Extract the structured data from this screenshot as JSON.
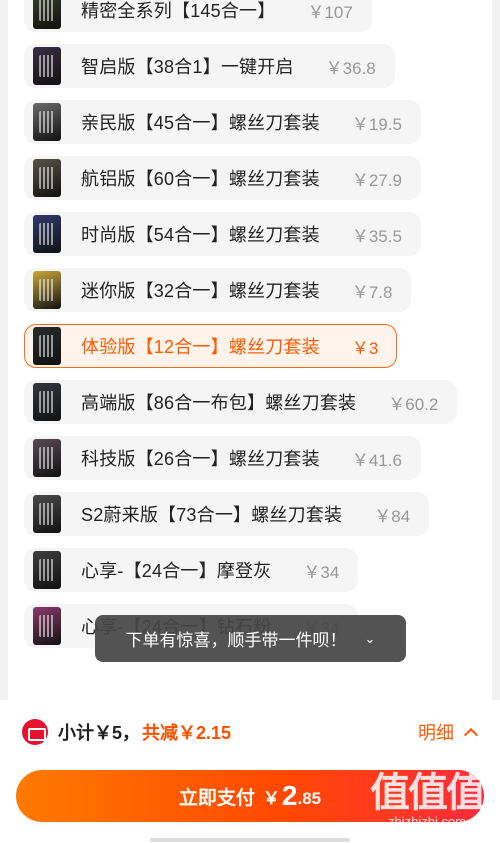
{
  "sku_list": {
    "items": [
      {
        "name": "精密全系列【145合一】",
        "price": "￥107",
        "thumb_color": "#3a3f2a",
        "selected": false
      },
      {
        "name": "智启版【38合1】一键开启",
        "price": "￥36.8",
        "thumb_color": "#3b2d45",
        "selected": false
      },
      {
        "name": "亲民版【45合一】螺丝刀套装",
        "price": "￥19.5",
        "thumb_color": "#6a6a6a",
        "selected": false
      },
      {
        "name": "航铝版【60合一】螺丝刀套装",
        "price": "￥27.9",
        "thumb_color": "#5a5248",
        "selected": false
      },
      {
        "name": "时尚版【54合一】螺丝刀套装",
        "price": "￥35.5",
        "thumb_color": "#2f3a6a",
        "selected": false
      },
      {
        "name": "迷你版【32合一】螺丝刀套装",
        "price": "￥7.8",
        "thumb_color": "#c9a93a",
        "selected": false
      },
      {
        "name": "体验版【12合一】螺丝刀套装",
        "price": "￥3",
        "thumb_color": "#2a2a2a",
        "selected": true
      },
      {
        "name": "高端版【86合一布包】螺丝刀套装",
        "price": "￥60.2",
        "thumb_color": "#33373d",
        "selected": false
      },
      {
        "name": "科技版【26合一】螺丝刀套装",
        "price": "￥41.6",
        "thumb_color": "#5a4a55",
        "selected": false
      },
      {
        "name": "S2蔚来版【73合一】螺丝刀套装",
        "price": "￥84",
        "thumb_color": "#4a4a4a",
        "selected": false
      },
      {
        "name": "心享-【24合一】摩登灰",
        "price": "￥34",
        "thumb_color": "#3d3d3d",
        "selected": false
      },
      {
        "name": "心享-【24合一】钻石粉",
        "price": "￥34",
        "thumb_color": "#8a3a6a",
        "selected": false
      }
    ]
  },
  "toast": {
    "text": "下单有惊喜，顺手带一件呗！",
    "arrow": "⌄"
  },
  "summary": {
    "subtotal": "小计￥5",
    "separator": "，",
    "discount": "共减￥2.15",
    "detail_label": "明细"
  },
  "pay_button": {
    "label": "立即支付",
    "currency": "￥",
    "amount_int": "2",
    "amount_dec": ".85"
  },
  "watermark": {
    "logo": "值值值",
    "url": "zhizhizhi.com"
  },
  "colors": {
    "accent": "#ff5a00",
    "discount_red": "#ff5000",
    "ticket_red": "#e8112d"
  }
}
